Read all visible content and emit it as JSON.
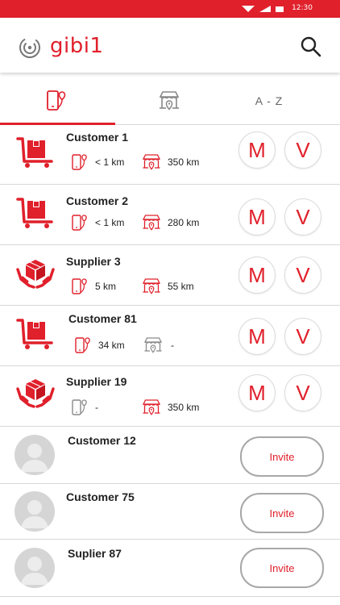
{
  "status_bar": {
    "time": "12:30"
  },
  "app_bar": {
    "logo_text": "gibi1"
  },
  "tabs": [
    {
      "icon": "phone-location-icon",
      "selected": true
    },
    {
      "icon": "store-location-icon",
      "selected": false
    },
    {
      "label": "A - Z",
      "selected": false
    }
  ],
  "accent_color": "#e0202b",
  "contacts": [
    {
      "type": "customer",
      "name": "Customer 1",
      "phone_distance": "< 1 km",
      "store_distance": "350 km",
      "buttons": [
        "M",
        "V"
      ]
    },
    {
      "type": "customer",
      "name": "Customer 2",
      "phone_distance": "< 1 km",
      "store_distance": "280 km",
      "buttons": [
        "M",
        "V"
      ]
    },
    {
      "type": "supplier",
      "name": "Supplier 3",
      "phone_distance": "5 km",
      "store_distance": "55 km",
      "buttons": [
        "M",
        "V"
      ]
    },
    {
      "type": "customer",
      "name": "Customer 81",
      "phone_distance": "34 km",
      "store_distance": "-",
      "buttons": [
        "M",
        "V"
      ]
    },
    {
      "type": "supplier",
      "name": "Supplier 19",
      "phone_distance": "-",
      "store_distance": "350 km",
      "buttons": [
        "M",
        "V"
      ]
    }
  ],
  "invites": [
    {
      "name": "Customer 12",
      "button": "Invite"
    },
    {
      "name": "Customer 75",
      "button": "Invite"
    },
    {
      "name": "Suplier 87",
      "button": "Invite"
    }
  ]
}
